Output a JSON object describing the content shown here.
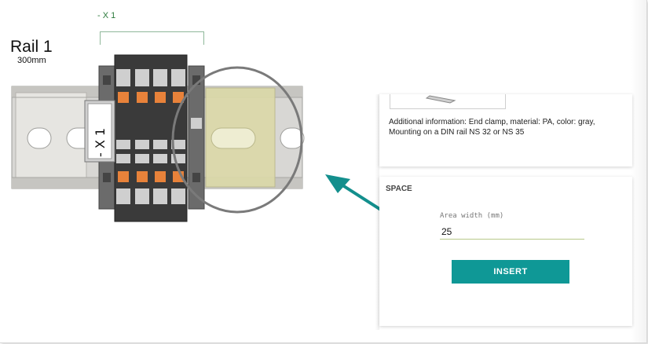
{
  "rail": {
    "title": "Rail 1",
    "length": "300mm"
  },
  "group": {
    "label": "- X 1",
    "marker_text": "- X 1"
  },
  "info": {
    "text": "Additional information: End clamp, material: PA, color: gray, Mounting on a DIN rail NS 32 or NS 35"
  },
  "space": {
    "title": "SPACE",
    "area_width_label": "Area width (mm)",
    "area_width_value": "25",
    "insert_label": "INSERT"
  },
  "colors": {
    "accent": "#0f9896",
    "terminal_orange": "#e8823a",
    "terminal_dark": "#3a3a3a",
    "highlight": "#dcd9a8",
    "arrow": "#138f8d"
  },
  "icons": {
    "pointer_arrow": "arrow-icon"
  }
}
